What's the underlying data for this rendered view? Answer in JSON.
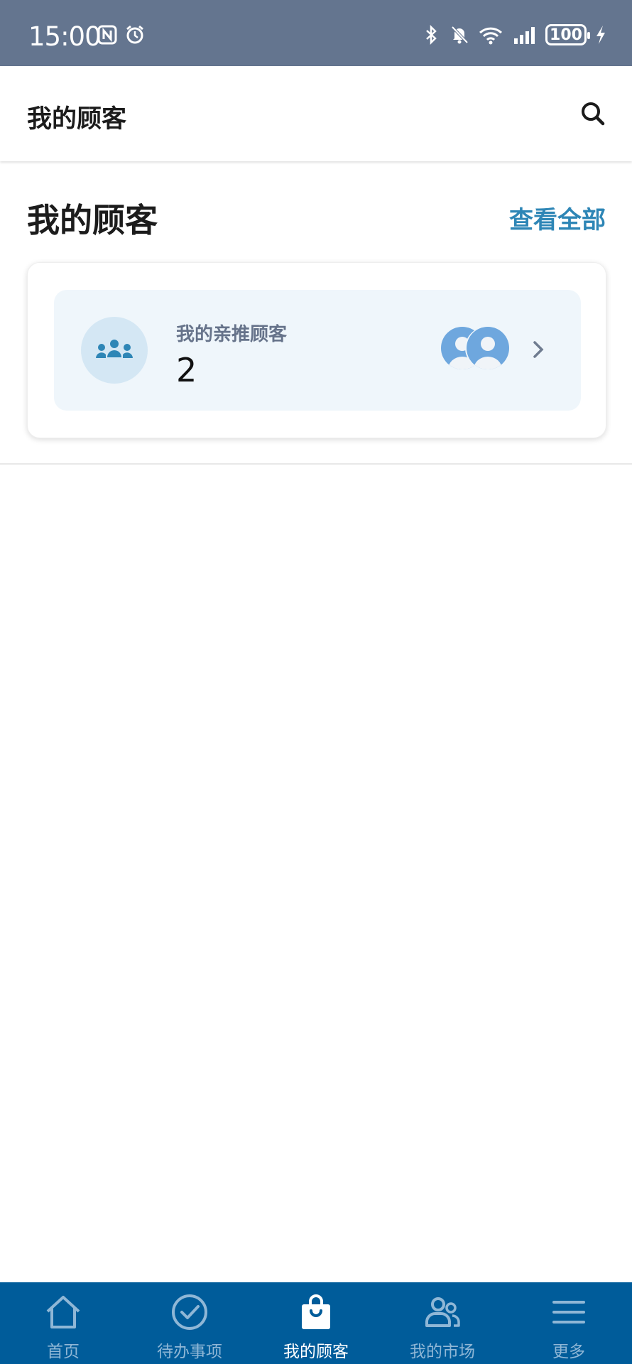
{
  "status_bar": {
    "time": "15:00",
    "battery": "100",
    "icons": [
      "nfc-icon",
      "alarm-icon",
      "bluetooth-icon",
      "mute-icon",
      "wifi-icon",
      "signal-icon",
      "battery-icon",
      "charging-icon"
    ]
  },
  "app_bar": {
    "title": "我的顾客",
    "search_icon": "search-icon"
  },
  "section": {
    "title": "我的顾客",
    "view_all": "查看全部"
  },
  "card": {
    "label": "我的亲推顾客",
    "count": "2",
    "icon": "group-icon"
  },
  "bottom_nav": [
    {
      "label": "首页",
      "icon": "home-icon",
      "active": false
    },
    {
      "label": "待办事项",
      "icon": "check-circle-icon",
      "active": false
    },
    {
      "label": "我的顾客",
      "icon": "shopping-bag-icon",
      "active": true
    },
    {
      "label": "我的市场",
      "icon": "people-icon",
      "active": false
    },
    {
      "label": "更多",
      "icon": "menu-icon",
      "active": false
    }
  ],
  "colors": {
    "status_bar": "#64758f",
    "accent": "#2e86b6",
    "nav_background": "#005c9a"
  }
}
